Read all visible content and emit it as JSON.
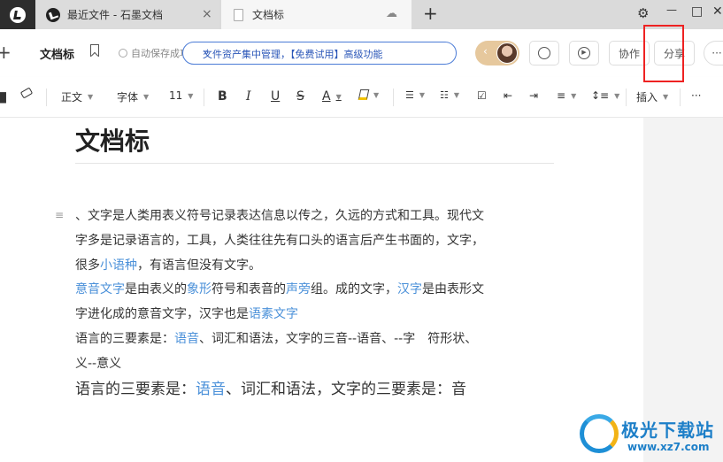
{
  "tabs": [
    {
      "label": "最近文件 - 石墨文档"
    },
    {
      "label": "文档标"
    }
  ],
  "tab_icons": {
    "close": "×",
    "cloud": "☁",
    "new_tab": "+",
    "settings": "⚙",
    "minimize": "—",
    "maximize": "□",
    "close_window": "✕"
  },
  "header": {
    "title": "文档标",
    "autosave": "自动保存成功",
    "promo": "文件资产集中管理，【免费试用】高级功能",
    "collab_label": "协作",
    "share_label": "分享"
  },
  "toolbar": {
    "paragraph_style": "正文",
    "font": "字体",
    "size": "11",
    "bold": "B",
    "italic": "I",
    "underline": "U",
    "strike": "S",
    "color": "A",
    "insert": "插入",
    "more": "···"
  },
  "document": {
    "title": "文档标",
    "lines": [
      [
        {
          "t": "、文字是人类用表义符号记录表达信息以传之，久远的方式和工具。现代文"
        }
      ],
      [
        {
          "t": "字多是记录语言的，工具，人类往往先有口头的语言后产生书面的，文字，"
        }
      ],
      [
        {
          "t": "很多"
        },
        {
          "t": "小语种",
          "link": true
        },
        {
          "t": "，有语言但没有文字。"
        }
      ],
      [
        {
          "t": "意音文字",
          "link": true
        },
        {
          "t": "是由表义的"
        },
        {
          "t": "象形",
          "link": true
        },
        {
          "t": "符号和表音的"
        },
        {
          "t": "声旁",
          "link": true
        },
        {
          "t": "组。成的文字，"
        },
        {
          "t": "汉字",
          "link": true
        },
        {
          "t": "是由表形文"
        }
      ],
      [
        {
          "t": "字进化成的意音文字，汉字也是"
        },
        {
          "t": "语素文字",
          "link": true
        }
      ],
      [
        {
          "t": "语言的三要素是："
        },
        {
          "t": "语音",
          "link": true
        },
        {
          "t": "、词汇和语法，文字的三音--语音、--字　符形状、"
        }
      ],
      [
        {
          "t": "义--意义"
        }
      ],
      [
        {
          "t": "语言的三要素是："
        },
        {
          "t": "语音",
          "link": true
        },
        {
          "t": "、词汇和语法，文字的三要素是：音"
        }
      ]
    ]
  },
  "watermark": {
    "name": "极光下载站",
    "url": "www.xz7.com"
  },
  "colors": {
    "link": "#4a90d9",
    "highlight": "#e22222",
    "promo_border": "#4a7bd6"
  }
}
